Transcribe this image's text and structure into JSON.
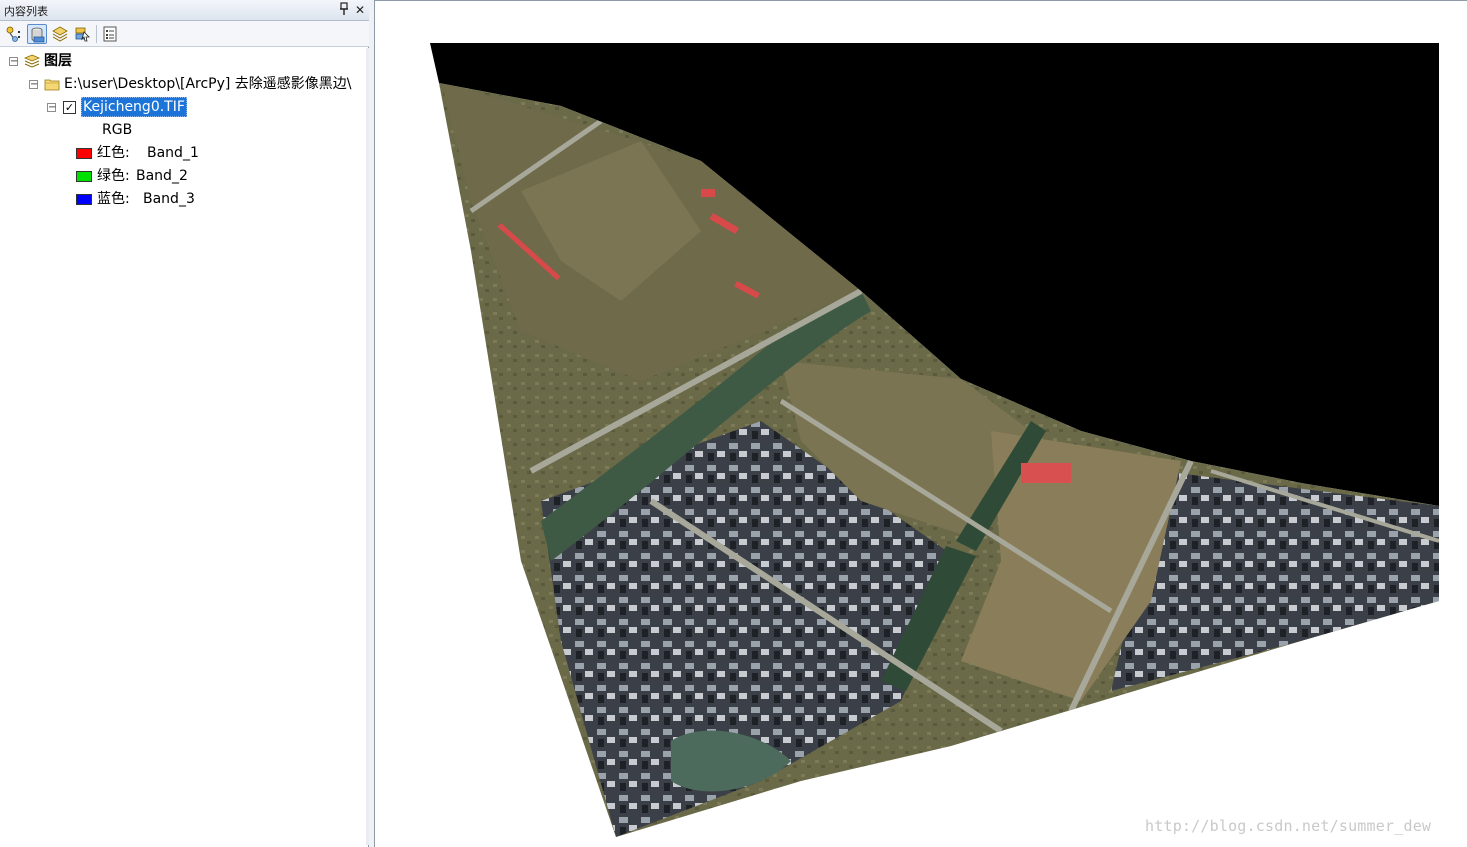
{
  "panel": {
    "title": "内容列表",
    "pin_glyph": "p",
    "close_glyph": "✕"
  },
  "toolbar": {
    "tools": [
      {
        "name": "list-by-drawing-order",
        "icon": "layers-drawing-order-icon"
      },
      {
        "name": "list-by-source",
        "icon": "database-source-icon",
        "active": true
      },
      {
        "name": "list-by-visibility",
        "icon": "layer-stack-icon"
      },
      {
        "name": "list-by-selection",
        "icon": "selection-list-icon"
      },
      {
        "name": "options",
        "icon": "options-list-icon"
      }
    ]
  },
  "tree": {
    "root_label": "图层",
    "source_path": "E:\\user\\Desktop\\[ArcPy] 去除遥感影像黑边\\",
    "layer_name": "Kejicheng0.TIF",
    "renderer_label": "RGB",
    "bands": [
      {
        "prefix": "红色:",
        "band": "Band_1",
        "color": "#ff0000"
      },
      {
        "prefix": "绿色:",
        "band": "Band_2",
        "color": "#00e000"
      },
      {
        "prefix": "蓝色:",
        "band": "Band_3",
        "color": "#0000ff"
      }
    ],
    "checked_glyph": "✓",
    "expanded_glyph": "−"
  },
  "map": {
    "black_border_color": "#000000",
    "background_color": "#ffffff"
  },
  "watermark": "http://blog.csdn.net/summer_dew"
}
